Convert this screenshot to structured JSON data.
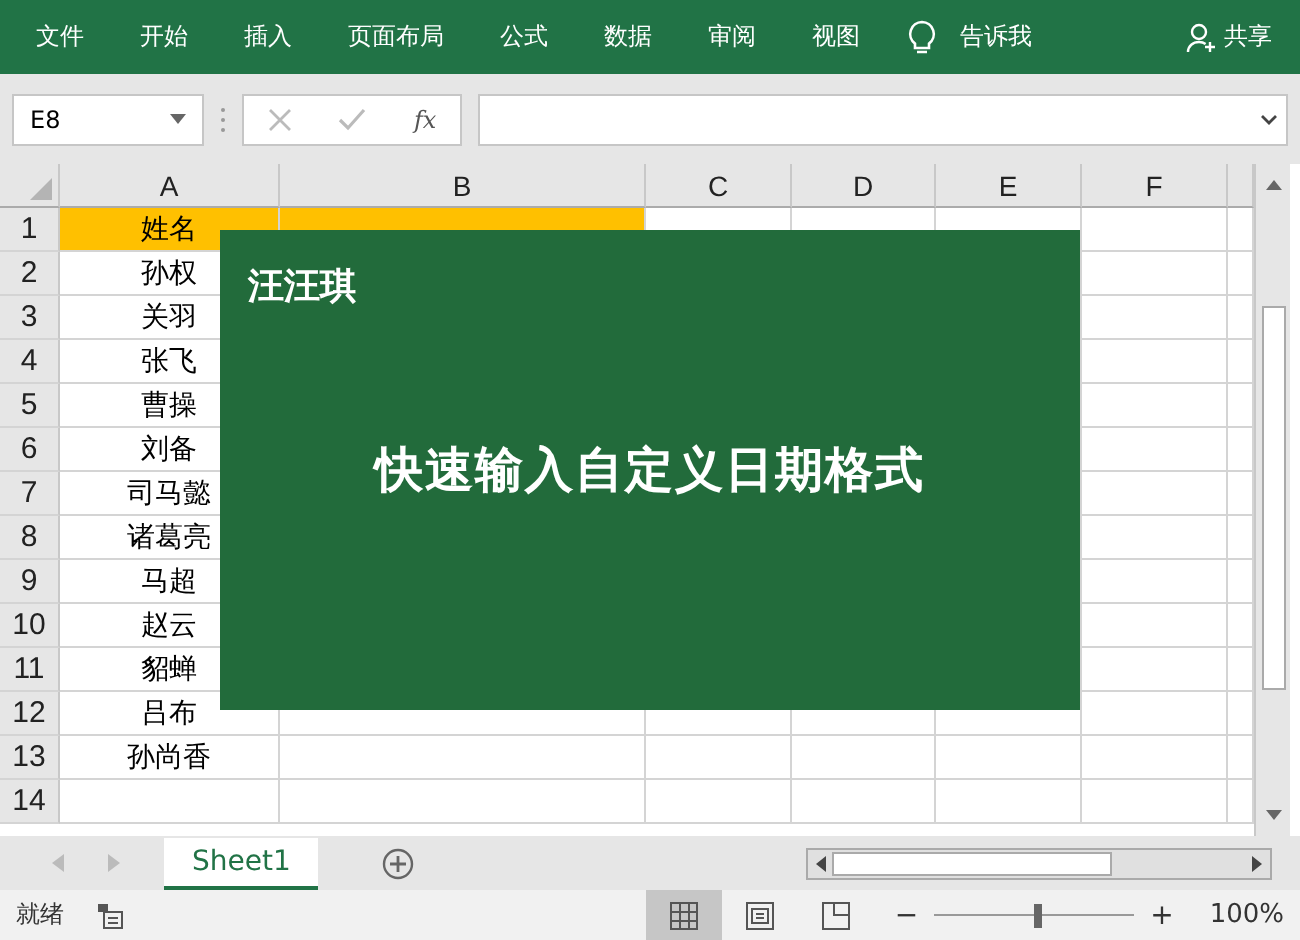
{
  "ribbon": {
    "tabs": [
      {
        "label": "文件"
      },
      {
        "label": "开始"
      },
      {
        "label": "插入"
      },
      {
        "label": "页面布局"
      },
      {
        "label": "公式"
      },
      {
        "label": "数据"
      },
      {
        "label": "审阅"
      },
      {
        "label": "视图"
      }
    ],
    "tell_me": "告诉我",
    "share": "共享"
  },
  "formula_bar": {
    "name_box": "E8",
    "fx": "fx"
  },
  "sheet": {
    "columns": [
      "A",
      "B",
      "C",
      "D",
      "E",
      "F"
    ],
    "rows": [
      {
        "number": "1",
        "highlighted": true,
        "cells": [
          "姓名"
        ]
      },
      {
        "number": "2",
        "highlighted": false,
        "cells": [
          "孙权"
        ]
      },
      {
        "number": "3",
        "highlighted": false,
        "cells": [
          "关羽"
        ]
      },
      {
        "number": "4",
        "highlighted": false,
        "cells": [
          "张飞"
        ]
      },
      {
        "number": "5",
        "highlighted": false,
        "cells": [
          "曹操"
        ]
      },
      {
        "number": "6",
        "highlighted": false,
        "cells": [
          "刘备"
        ]
      },
      {
        "number": "7",
        "highlighted": false,
        "cells": [
          "司马懿"
        ]
      },
      {
        "number": "8",
        "highlighted": false,
        "cells": [
          "诸葛亮"
        ]
      },
      {
        "number": "9",
        "highlighted": false,
        "cells": [
          "马超"
        ]
      },
      {
        "number": "10",
        "highlighted": false,
        "cells": [
          "赵云"
        ]
      },
      {
        "number": "11",
        "highlighted": false,
        "cells": [
          "貂蝉"
        ]
      },
      {
        "number": "12",
        "highlighted": false,
        "cells": [
          "吕布"
        ]
      },
      {
        "number": "13",
        "highlighted": false,
        "cells": [
          "孙尚香"
        ]
      },
      {
        "number": "14",
        "highlighted": false,
        "cells": []
      }
    ]
  },
  "overlay": {
    "author": "汪汪琪",
    "title": "快速输入自定义日期格式"
  },
  "sheet_tabs": [
    {
      "label": "Sheet1",
      "selected": true
    }
  ],
  "status_bar": {
    "status": "就绪",
    "views": [
      {
        "selected": true
      },
      {
        "selected": false
      },
      {
        "selected": false
      }
    ],
    "zoom_out": "−",
    "zoom": {
      "level": 0.52
    },
    "zoom_in": "+",
    "zoom_reading": "100%"
  }
}
